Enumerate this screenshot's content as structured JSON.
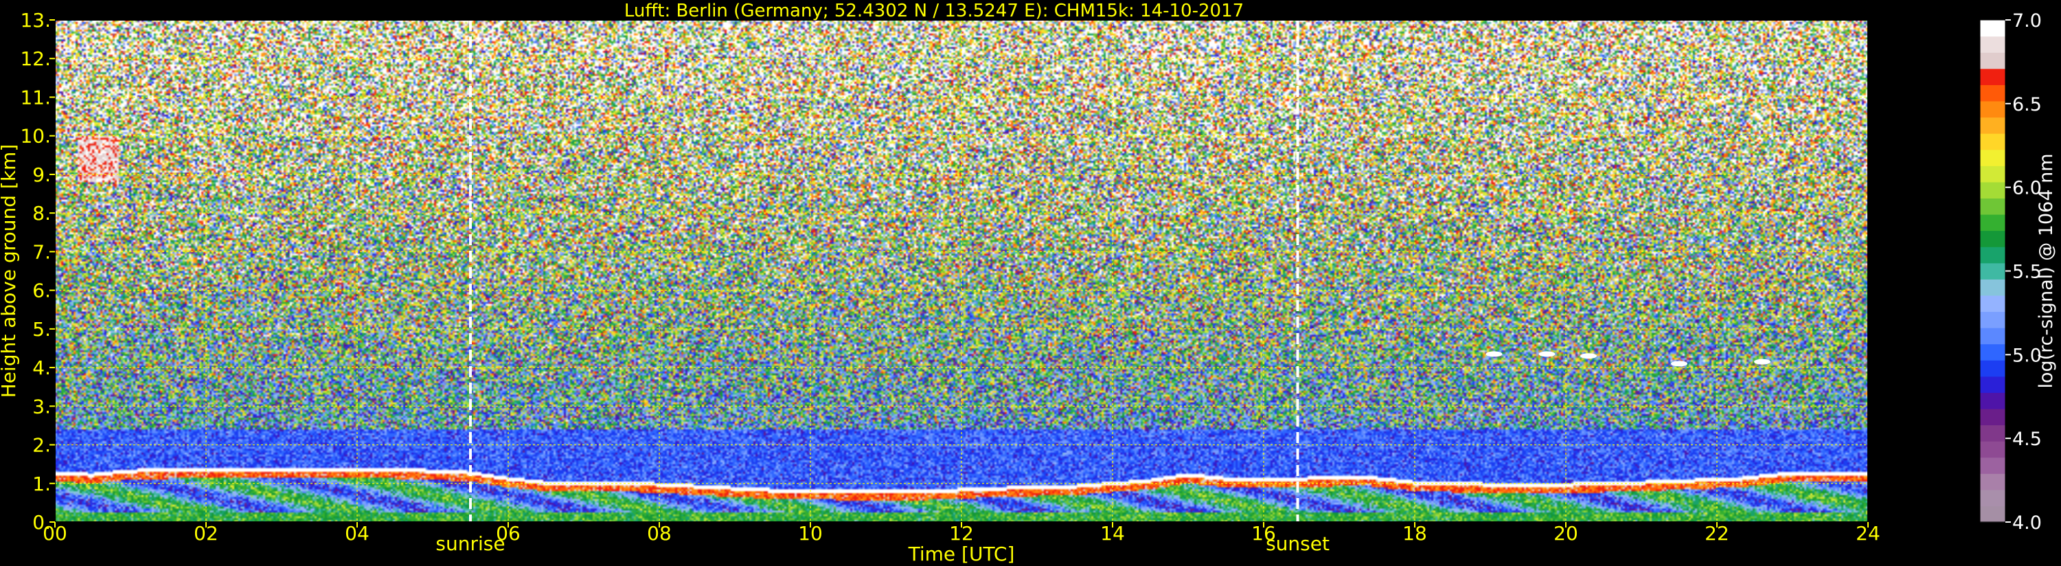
{
  "chart_data": {
    "type": "heatmap",
    "title": "Lufft: Berlin (Germany; 52.4302 N / 13.5247 E):    CHM15k: 14-10-2017",
    "xlabel": "Time [UTC]",
    "ylabel": "Height above ground [km]",
    "xlim": [
      0,
      24
    ],
    "ylim": [
      0,
      13
    ],
    "x_ticks": [
      {
        "value": 0,
        "label": "00"
      },
      {
        "value": 2,
        "label": "02"
      },
      {
        "value": 4,
        "label": "04"
      },
      {
        "value": 6,
        "label": "06"
      },
      {
        "value": 8,
        "label": "08"
      },
      {
        "value": 10,
        "label": "10"
      },
      {
        "value": 12,
        "label": "12"
      },
      {
        "value": 14,
        "label": "14"
      },
      {
        "value": 16,
        "label": "16"
      },
      {
        "value": 18,
        "label": "18"
      },
      {
        "value": 20,
        "label": "20"
      },
      {
        "value": 22,
        "label": "22"
      },
      {
        "value": 24,
        "label": "24"
      }
    ],
    "y_ticks": [
      {
        "value": 0,
        "label": "0."
      },
      {
        "value": 1,
        "label": "1."
      },
      {
        "value": 2,
        "label": "2."
      },
      {
        "value": 3,
        "label": "3."
      },
      {
        "value": 4,
        "label": "4."
      },
      {
        "value": 5,
        "label": "5."
      },
      {
        "value": 6,
        "label": "6."
      },
      {
        "value": 7,
        "label": "7."
      },
      {
        "value": 8,
        "label": "8."
      },
      {
        "value": 9,
        "label": "9."
      },
      {
        "value": 10,
        "label": "10."
      },
      {
        "value": 11,
        "label": "11."
      },
      {
        "value": 12,
        "label": "12."
      },
      {
        "value": 13,
        "label": "13."
      }
    ],
    "grid": true,
    "annotations": [
      {
        "label": "sunrise",
        "x": 5.5
      },
      {
        "label": "sunset",
        "x": 16.45
      }
    ],
    "colorbar": {
      "label": "log(rc-signal) @ 1064 nm",
      "range": [
        4.0,
        7.0
      ],
      "ticks": [
        {
          "value": 4.0,
          "label": "4.0"
        },
        {
          "value": 4.5,
          "label": "4.5"
        },
        {
          "value": 5.0,
          "label": "5.0"
        },
        {
          "value": 5.5,
          "label": "5.5"
        },
        {
          "value": 6.0,
          "label": "6.0"
        },
        {
          "value": 6.5,
          "label": "6.5"
        },
        {
          "value": 7.0,
          "label": "7.0"
        }
      ],
      "colors": [
        "#a58fa5",
        "#a98fab",
        "#a980a9",
        "#9c62a0",
        "#8e4a93",
        "#80388a",
        "#6a1e8a",
        "#4e14a8",
        "#2a20d8",
        "#1c3ef2",
        "#2f66ff",
        "#5b88ff",
        "#7a9fff",
        "#94b3ff",
        "#86c4dc",
        "#3fb9a3",
        "#18a36b",
        "#149838",
        "#34b030",
        "#6fc636",
        "#a4dc36",
        "#d2ea36",
        "#f2f030",
        "#ffd628",
        "#ffb020",
        "#ff8a10",
        "#ff5a08",
        "#f02010",
        "#e0cccc",
        "#ecdede",
        "#ffffff"
      ]
    },
    "features": {
      "boundary_layer_top_km": [
        {
          "x": 0.0,
          "h": 1.2
        },
        {
          "x": 0.5,
          "h": 1.15
        },
        {
          "x": 1.0,
          "h": 1.25
        },
        {
          "x": 2.0,
          "h": 1.3
        },
        {
          "x": 3.0,
          "h": 1.3
        },
        {
          "x": 4.0,
          "h": 1.3
        },
        {
          "x": 5.0,
          "h": 1.25
        },
        {
          "x": 5.5,
          "h": 1.2
        },
        {
          "x": 6.0,
          "h": 1.05
        },
        {
          "x": 6.5,
          "h": 0.95
        },
        {
          "x": 7.5,
          "h": 0.95
        },
        {
          "x": 8.5,
          "h": 0.85
        },
        {
          "x": 9.5,
          "h": 0.75
        },
        {
          "x": 10.5,
          "h": 0.72
        },
        {
          "x": 11.5,
          "h": 0.72
        },
        {
          "x": 12.5,
          "h": 0.8
        },
        {
          "x": 13.5,
          "h": 0.85
        },
        {
          "x": 14.5,
          "h": 1.0
        },
        {
          "x": 15.0,
          "h": 1.15
        },
        {
          "x": 15.5,
          "h": 1.05
        },
        {
          "x": 16.5,
          "h": 1.05
        },
        {
          "x": 17.3,
          "h": 1.1
        },
        {
          "x": 18.0,
          "h": 0.95
        },
        {
          "x": 19.0,
          "h": 0.9
        },
        {
          "x": 20.0,
          "h": 0.9
        },
        {
          "x": 21.0,
          "h": 0.95
        },
        {
          "x": 22.3,
          "h": 1.05
        },
        {
          "x": 23.0,
          "h": 1.2
        },
        {
          "x": 24.0,
          "h": 1.2
        }
      ],
      "cirrus_patch": {
        "x0": 0.3,
        "x1": 0.85,
        "y0": 8.8,
        "y1": 10.0
      },
      "small_clouds": [
        {
          "x": 19.05,
          "y": 4.35
        },
        {
          "x": 19.75,
          "y": 4.35
        },
        {
          "x": 20.3,
          "y": 4.3
        },
        {
          "x": 21.5,
          "y": 4.1
        },
        {
          "x": 22.6,
          "y": 4.15
        }
      ]
    }
  }
}
